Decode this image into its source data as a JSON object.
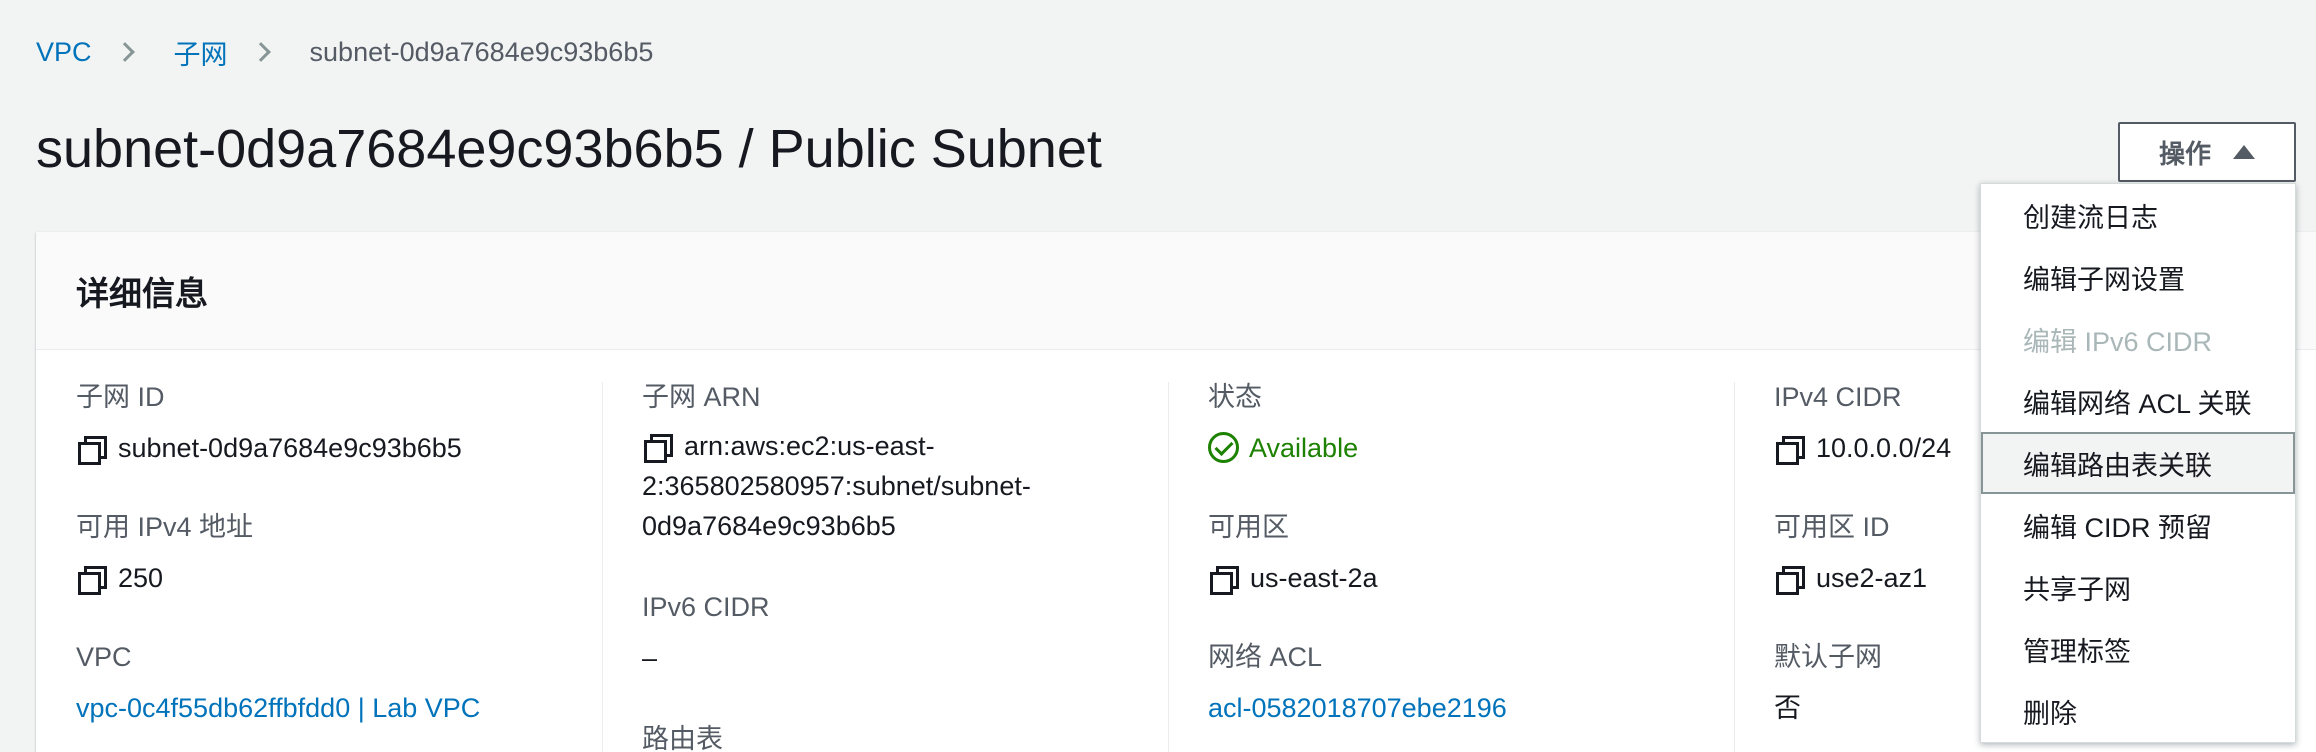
{
  "breadcrumb": {
    "items": [
      "VPC",
      "子网"
    ],
    "current": "subnet-0d9a7684e9c93b6b5"
  },
  "page": {
    "title": "subnet-0d9a7684e9c93b6b5 / Public Subnet"
  },
  "actions": {
    "label": "操作",
    "menu": [
      {
        "label": "创建流日志",
        "disabled": false
      },
      {
        "label": "编辑子网设置",
        "disabled": false
      },
      {
        "label": "编辑 IPv6 CIDR",
        "disabled": true
      },
      {
        "label": "编辑网络 ACL 关联",
        "disabled": false
      },
      {
        "label": "编辑路由表关联",
        "disabled": false,
        "hovered": true
      },
      {
        "label": "编辑 CIDR 预留",
        "disabled": false
      },
      {
        "label": "共享子网",
        "disabled": false
      },
      {
        "label": "管理标签",
        "disabled": false
      },
      {
        "label": "删除",
        "disabled": false
      }
    ]
  },
  "details": {
    "title": "详细信息",
    "col1": {
      "subnet_id_label": "子网 ID",
      "subnet_id": "subnet-0d9a7684e9c93b6b5",
      "available_ipv4_label": "可用 IPv4 地址",
      "available_ipv4": "250",
      "vpc_label": "VPC",
      "vpc": "vpc-0c4f55db62ffbfdd0 | Lab VPC"
    },
    "col2": {
      "arn_label": "子网 ARN",
      "arn_line1": "arn:aws:ec2:us-east-",
      "arn_line2": "2:365802580957:subnet/subnet-",
      "arn_line3": "0d9a7684e9c93b6b5",
      "ipv6_label": "IPv6 CIDR",
      "ipv6": "–",
      "route_table_label": "路由表"
    },
    "col3": {
      "state_label": "状态",
      "state": "Available",
      "az_label": "可用区",
      "az": "us-east-2a",
      "acl_label": "网络 ACL",
      "acl": "acl-0582018707ebe2196"
    },
    "col4": {
      "ipv4_cidr_label": "IPv4 CIDR",
      "ipv4_cidr": "10.0.0.0/24",
      "az_id_label": "可用区 ID",
      "az_id": "use2-az1",
      "default_subnet_label": "默认子网",
      "default_subnet": "否"
    }
  },
  "colors": {
    "link": "#0073bb",
    "success": "#1d8102",
    "background": "#f2f3f3"
  }
}
